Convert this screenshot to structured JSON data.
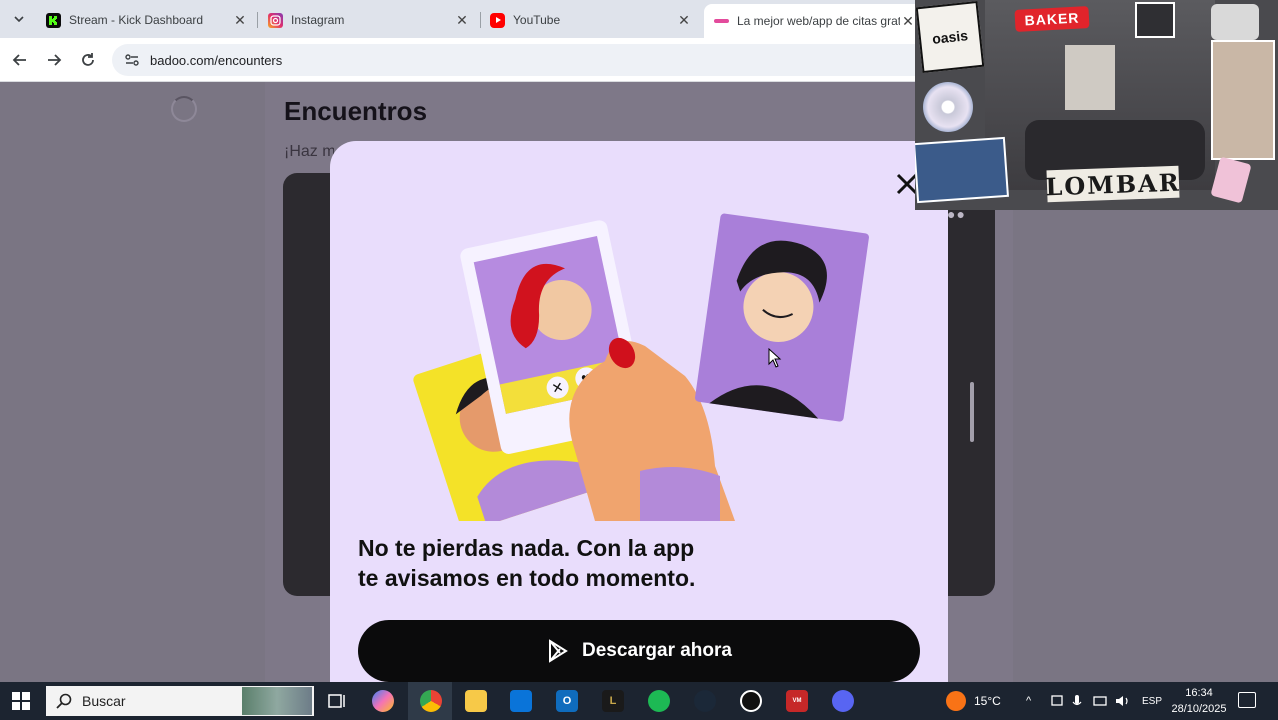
{
  "browser": {
    "tabs": [
      {
        "title": "Stream - Kick Dashboard",
        "icon": "kick-icon",
        "color": "#53fc18"
      },
      {
        "title": "Instagram",
        "icon": "instagram-icon",
        "color": "#e1306c"
      },
      {
        "title": "YouTube",
        "icon": "youtube-icon",
        "color": "#ff0000"
      },
      {
        "title": "La mejor web/app de citas grat",
        "icon": "badoo-icon",
        "color": "#e34b9c",
        "active": true
      }
    ],
    "url": "badoo.com/encounters"
  },
  "page": {
    "title": "Encuentros",
    "subtitle": "¡Haz ma"
  },
  "modal": {
    "heading_line1": "No te pierdas nada. Con la app",
    "heading_line2": "te avisamos en todo momento.",
    "cta_label": "Descargar ahora",
    "background": "#e9ddfc"
  },
  "overlay": {
    "sticker_1": "oasis",
    "sticker_2": "BAKER",
    "sticker_3": "LOMBAR"
  },
  "taskbar": {
    "search_label": "Buscar",
    "weather": "15°C",
    "language": "ESP",
    "time": "16:34",
    "date": "28/10/2025"
  }
}
